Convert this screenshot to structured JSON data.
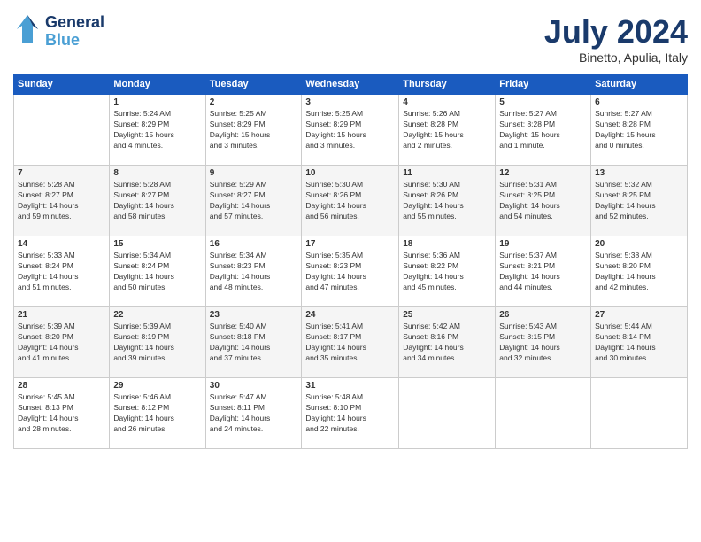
{
  "header": {
    "logo_general": "General",
    "logo_blue": "Blue",
    "month_title": "July 2024",
    "location": "Binetto, Apulia, Italy"
  },
  "columns": [
    "Sunday",
    "Monday",
    "Tuesday",
    "Wednesday",
    "Thursday",
    "Friday",
    "Saturday"
  ],
  "weeks": [
    [
      {
        "day": "",
        "info": ""
      },
      {
        "day": "1",
        "info": "Sunrise: 5:24 AM\nSunset: 8:29 PM\nDaylight: 15 hours\nand 4 minutes."
      },
      {
        "day": "2",
        "info": "Sunrise: 5:25 AM\nSunset: 8:29 PM\nDaylight: 15 hours\nand 3 minutes."
      },
      {
        "day": "3",
        "info": "Sunrise: 5:25 AM\nSunset: 8:29 PM\nDaylight: 15 hours\nand 3 minutes."
      },
      {
        "day": "4",
        "info": "Sunrise: 5:26 AM\nSunset: 8:28 PM\nDaylight: 15 hours\nand 2 minutes."
      },
      {
        "day": "5",
        "info": "Sunrise: 5:27 AM\nSunset: 8:28 PM\nDaylight: 15 hours\nand 1 minute."
      },
      {
        "day": "6",
        "info": "Sunrise: 5:27 AM\nSunset: 8:28 PM\nDaylight: 15 hours\nand 0 minutes."
      }
    ],
    [
      {
        "day": "7",
        "info": "Sunrise: 5:28 AM\nSunset: 8:27 PM\nDaylight: 14 hours\nand 59 minutes."
      },
      {
        "day": "8",
        "info": "Sunrise: 5:28 AM\nSunset: 8:27 PM\nDaylight: 14 hours\nand 58 minutes."
      },
      {
        "day": "9",
        "info": "Sunrise: 5:29 AM\nSunset: 8:27 PM\nDaylight: 14 hours\nand 57 minutes."
      },
      {
        "day": "10",
        "info": "Sunrise: 5:30 AM\nSunset: 8:26 PM\nDaylight: 14 hours\nand 56 minutes."
      },
      {
        "day": "11",
        "info": "Sunrise: 5:30 AM\nSunset: 8:26 PM\nDaylight: 14 hours\nand 55 minutes."
      },
      {
        "day": "12",
        "info": "Sunrise: 5:31 AM\nSunset: 8:25 PM\nDaylight: 14 hours\nand 54 minutes."
      },
      {
        "day": "13",
        "info": "Sunrise: 5:32 AM\nSunset: 8:25 PM\nDaylight: 14 hours\nand 52 minutes."
      }
    ],
    [
      {
        "day": "14",
        "info": "Sunrise: 5:33 AM\nSunset: 8:24 PM\nDaylight: 14 hours\nand 51 minutes."
      },
      {
        "day": "15",
        "info": "Sunrise: 5:34 AM\nSunset: 8:24 PM\nDaylight: 14 hours\nand 50 minutes."
      },
      {
        "day": "16",
        "info": "Sunrise: 5:34 AM\nSunset: 8:23 PM\nDaylight: 14 hours\nand 48 minutes."
      },
      {
        "day": "17",
        "info": "Sunrise: 5:35 AM\nSunset: 8:23 PM\nDaylight: 14 hours\nand 47 minutes."
      },
      {
        "day": "18",
        "info": "Sunrise: 5:36 AM\nSunset: 8:22 PM\nDaylight: 14 hours\nand 45 minutes."
      },
      {
        "day": "19",
        "info": "Sunrise: 5:37 AM\nSunset: 8:21 PM\nDaylight: 14 hours\nand 44 minutes."
      },
      {
        "day": "20",
        "info": "Sunrise: 5:38 AM\nSunset: 8:20 PM\nDaylight: 14 hours\nand 42 minutes."
      }
    ],
    [
      {
        "day": "21",
        "info": "Sunrise: 5:39 AM\nSunset: 8:20 PM\nDaylight: 14 hours\nand 41 minutes."
      },
      {
        "day": "22",
        "info": "Sunrise: 5:39 AM\nSunset: 8:19 PM\nDaylight: 14 hours\nand 39 minutes."
      },
      {
        "day": "23",
        "info": "Sunrise: 5:40 AM\nSunset: 8:18 PM\nDaylight: 14 hours\nand 37 minutes."
      },
      {
        "day": "24",
        "info": "Sunrise: 5:41 AM\nSunset: 8:17 PM\nDaylight: 14 hours\nand 35 minutes."
      },
      {
        "day": "25",
        "info": "Sunrise: 5:42 AM\nSunset: 8:16 PM\nDaylight: 14 hours\nand 34 minutes."
      },
      {
        "day": "26",
        "info": "Sunrise: 5:43 AM\nSunset: 8:15 PM\nDaylight: 14 hours\nand 32 minutes."
      },
      {
        "day": "27",
        "info": "Sunrise: 5:44 AM\nSunset: 8:14 PM\nDaylight: 14 hours\nand 30 minutes."
      }
    ],
    [
      {
        "day": "28",
        "info": "Sunrise: 5:45 AM\nSunset: 8:13 PM\nDaylight: 14 hours\nand 28 minutes."
      },
      {
        "day": "29",
        "info": "Sunrise: 5:46 AM\nSunset: 8:12 PM\nDaylight: 14 hours\nand 26 minutes."
      },
      {
        "day": "30",
        "info": "Sunrise: 5:47 AM\nSunset: 8:11 PM\nDaylight: 14 hours\nand 24 minutes."
      },
      {
        "day": "31",
        "info": "Sunrise: 5:48 AM\nSunset: 8:10 PM\nDaylight: 14 hours\nand 22 minutes."
      },
      {
        "day": "",
        "info": ""
      },
      {
        "day": "",
        "info": ""
      },
      {
        "day": "",
        "info": ""
      }
    ]
  ]
}
